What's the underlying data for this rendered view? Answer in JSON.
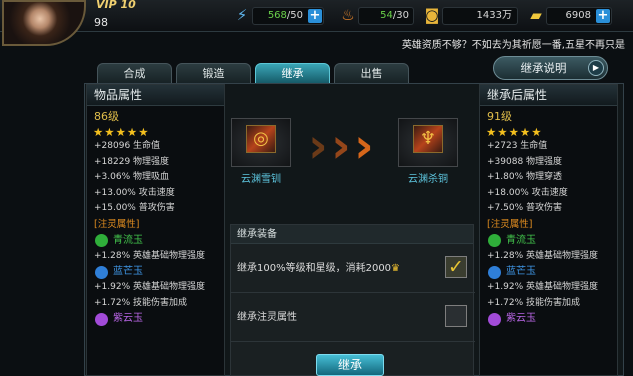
{
  "player": {
    "level": "98",
    "vip": "VIP 10"
  },
  "resources": {
    "stamina": {
      "current": "568",
      "max": "/50"
    },
    "vigor": {
      "current": "54",
      "max": "/30"
    },
    "coins": "1433万",
    "ingots": "6908"
  },
  "notice": "英雄资质不够？不如去为其祈愿一番,五星不再只是",
  "tabs": [
    "合成",
    "锻造",
    "继承",
    "出售"
  ],
  "explain_button": "继承说明",
  "left_panel": {
    "header": "物品属性",
    "level": "86级",
    "stars": "★★★★★",
    "stats": [
      "+28096 生命值",
      "+18229 物理强度",
      "+3.06% 物理吸血",
      "+13.00% 攻击速度",
      "+15.00% 普攻伤害"
    ],
    "infuse_title": "[注灵属性]",
    "gems": [
      {
        "name": "青流玉",
        "color": "#2fae3a",
        "effects": [
          "+1.28% 英雄基础物理强度"
        ]
      },
      {
        "name": "蓝芒玉",
        "color": "#2f7fd8",
        "effects": [
          "+1.92% 英雄基础物理强度",
          "+1.72% 技能伤害加成"
        ]
      },
      {
        "name": "紫云玉",
        "color": "#a24bd8",
        "effects": []
      }
    ]
  },
  "right_panel": {
    "header": "继承后属性",
    "level": "91级",
    "stars": "★★★★★",
    "stats": [
      "+2723 生命值",
      "+39088 物理强度",
      "+1.80% 物理穿透",
      "+18.00% 攻击速度",
      "+7.50% 普攻伤害"
    ],
    "infuse_title": "[注灵属性]",
    "gems": [
      {
        "name": "青流玉",
        "color": "#2fae3a",
        "effects": [
          "+1.28% 英雄基础物理强度"
        ]
      },
      {
        "name": "蓝芒玉",
        "color": "#2f7fd8",
        "effects": [
          "+1.92% 英雄基础物理强度",
          "+1.72% 技能伤害加成"
        ]
      },
      {
        "name": "紫云玉",
        "color": "#a24bd8",
        "effects": []
      }
    ]
  },
  "source_item": "云渊雪钏",
  "target_item": "云渊杀铜",
  "equip": {
    "title": "继承装备",
    "option1": "继承100%等级和星级，消耗2000",
    "option2": "继承注灵属性"
  },
  "inherit_button": "继承"
}
